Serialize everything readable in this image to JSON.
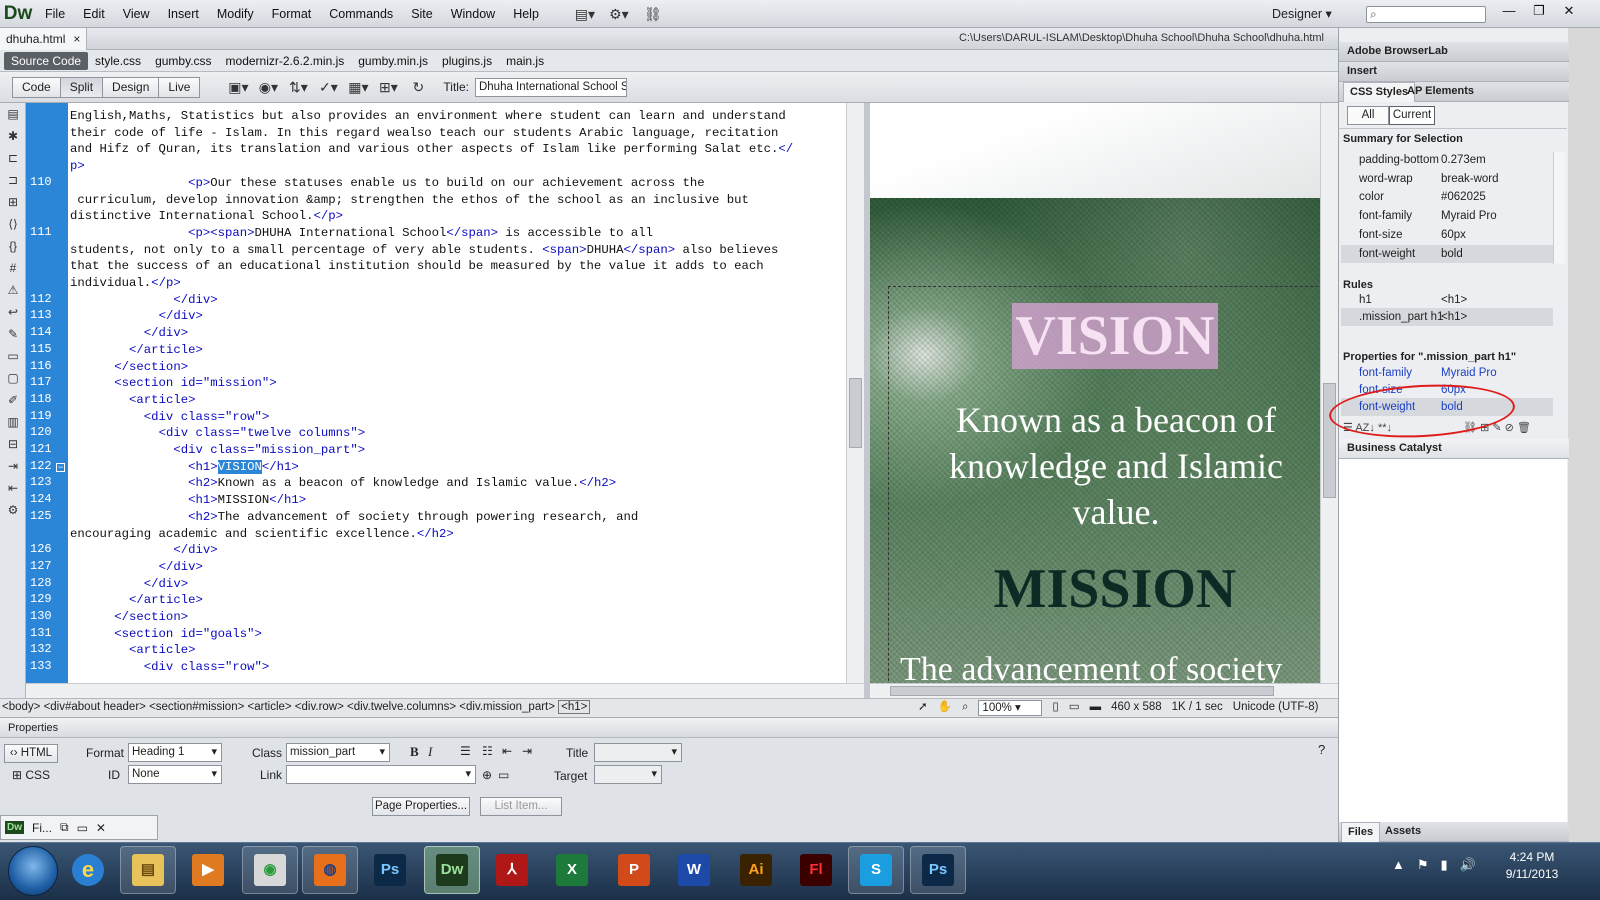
{
  "app": {
    "logo": "Dw",
    "menus": [
      "File",
      "Edit",
      "View",
      "Insert",
      "Modify",
      "Format",
      "Commands",
      "Site",
      "Window",
      "Help"
    ],
    "workspace": "Designer",
    "search_placeholder": ""
  },
  "document": {
    "tab": "dhuha.html",
    "close": "×",
    "path": "C:\\Users\\DARUL-ISLAM\\Desktop\\Dhuha School\\Dhuha School\\dhuha.html",
    "related_files": [
      "Source Code",
      "style.css",
      "gumby.css",
      "modernizr-2.6.2.min.js",
      "gumby.min.js",
      "plugins.js",
      "main.js"
    ]
  },
  "toolbar": {
    "views": [
      "Code",
      "Split",
      "Design",
      "Live"
    ],
    "active_view": "Split",
    "title_label": "Title:",
    "title_value": "Dhuha International School Sy"
  },
  "code": {
    "lines": [
      {
        "n": "",
        "t": "English,Maths, Statistics but also provides an environment where student can learn and understand"
      },
      {
        "n": "",
        "t": "their code of life - Islam. In this regard wealso teach our students Arabic language, recitation"
      },
      {
        "n": "",
        "t": "and Hifz of Quran, its translation and various other aspects of Islam like performing Salat etc.</"
      },
      {
        "n": "",
        "t": "p>"
      },
      {
        "n": "110",
        "t": "                <p>Our these statuses enable us to build on our achievement across the"
      },
      {
        "n": "",
        "t": " curriculum, develop innovation &amp; strengthen the ethos of the school as an inclusive but"
      },
      {
        "n": "",
        "t": "distinctive International School.</p>"
      },
      {
        "n": "111",
        "t": "                <p><span>DHUHA International School</span> is accessible to all"
      },
      {
        "n": "",
        "t": "students, not only to a small percentage of very able students. <span>DHUHA</span> also believes"
      },
      {
        "n": "",
        "t": "that the success of an educational institution should be measured by the value it adds to each"
      },
      {
        "n": "",
        "t": "individual.</p>"
      },
      {
        "n": "112",
        "t": "              </div>"
      },
      {
        "n": "113",
        "t": "            </div>"
      },
      {
        "n": "114",
        "t": "          </div>"
      },
      {
        "n": "115",
        "t": "        </article>"
      },
      {
        "n": "116",
        "t": "      </section>"
      },
      {
        "n": "117",
        "t": "      <section id=\"mission\">"
      },
      {
        "n": "118",
        "t": "        <article>"
      },
      {
        "n": "119",
        "t": "          <div class=\"row\">"
      },
      {
        "n": "120",
        "t": "            <div class=\"twelve columns\">"
      },
      {
        "n": "121",
        "t": "              <div class=\"mission_part\">"
      },
      {
        "n": "122",
        "t": "                <h1>VISION</h1>"
      },
      {
        "n": "123",
        "t": "                <h2>Known as a beacon of knowledge and Islamic value.</h2>"
      },
      {
        "n": "124",
        "t": "                <h1>MISSION</h1>"
      },
      {
        "n": "125",
        "t": "                <h2>The advancement of society through powering research, and"
      },
      {
        "n": "",
        "t": "encouraging academic and scientific excellence.</h2>"
      },
      {
        "n": "126",
        "t": "              </div>"
      },
      {
        "n": "127",
        "t": "            </div>"
      },
      {
        "n": "128",
        "t": "          </div>"
      },
      {
        "n": "129",
        "t": "        </article>"
      },
      {
        "n": "130",
        "t": "      </section>"
      },
      {
        "n": "131",
        "t": "      <section id=\"goals\">"
      },
      {
        "n": "132",
        "t": "        <article>"
      },
      {
        "n": "133",
        "t": "          <div class=\"row\">"
      }
    ],
    "selected_word": "VISION"
  },
  "design": {
    "vision": "VISION",
    "beacon": "Known as a beacon of knowledge and Islamic value.",
    "mission": "MISSION",
    "advance": "The advancement of society"
  },
  "status": {
    "tag_path": "<body> <div#about header> <section#mission> <article> <div.row> <div.twelve.columns> <div.mission_part>",
    "current_tag": "<h1>",
    "zoom": "100%",
    "size": "460 x 588",
    "download": "1K / 1 sec",
    "encoding": "Unicode (UTF-8)"
  },
  "properties": {
    "title": "Properties",
    "html_label": "HTML",
    "css_label": "CSS",
    "format_label": "Format",
    "format_value": "Heading 1",
    "id_label": "ID",
    "id_value": "None",
    "class_label": "Class",
    "class_value": "mission_part",
    "link_label": "Link",
    "title_label": "Title",
    "target_label": "Target",
    "page_props": "Page Properties...",
    "list_item": "List Item...",
    "bold": "B",
    "italic": "I"
  },
  "mini_window": {
    "label": "Fi..."
  },
  "panel": {
    "browserlab": "Adobe BrowserLab",
    "insert": "Insert",
    "tabs": [
      "CSS Styles",
      "AP Elements"
    ],
    "toggle": [
      "All",
      "Current"
    ],
    "summary_title": "Summary for Selection",
    "summary": [
      {
        "k": "padding-bottom",
        "v": "0.273em"
      },
      {
        "k": "word-wrap",
        "v": "break-word"
      },
      {
        "k": "color",
        "v": "#062025"
      },
      {
        "k": "font-family",
        "v": "Myraid Pro"
      },
      {
        "k": "font-size",
        "v": "60px"
      },
      {
        "k": "font-weight",
        "v": "bold"
      }
    ],
    "rules_title": "Rules",
    "rules": [
      {
        "k": "h1",
        "v": "<h1>"
      },
      {
        "k": ".mission_part h1",
        "v": "<h1>"
      }
    ],
    "props_title": "Properties for \".mission_part h1\"",
    "props": [
      {
        "k": "font-family",
        "v": "Myraid Pro"
      },
      {
        "k": "font-size",
        "v": "60px"
      },
      {
        "k": "font-weight",
        "v": "bold"
      }
    ],
    "business": "Business Catalyst",
    "files_tabs": [
      "Files",
      "Assets"
    ]
  },
  "taskbar": {
    "time": "4:24 PM",
    "date": "9/11/2013"
  }
}
